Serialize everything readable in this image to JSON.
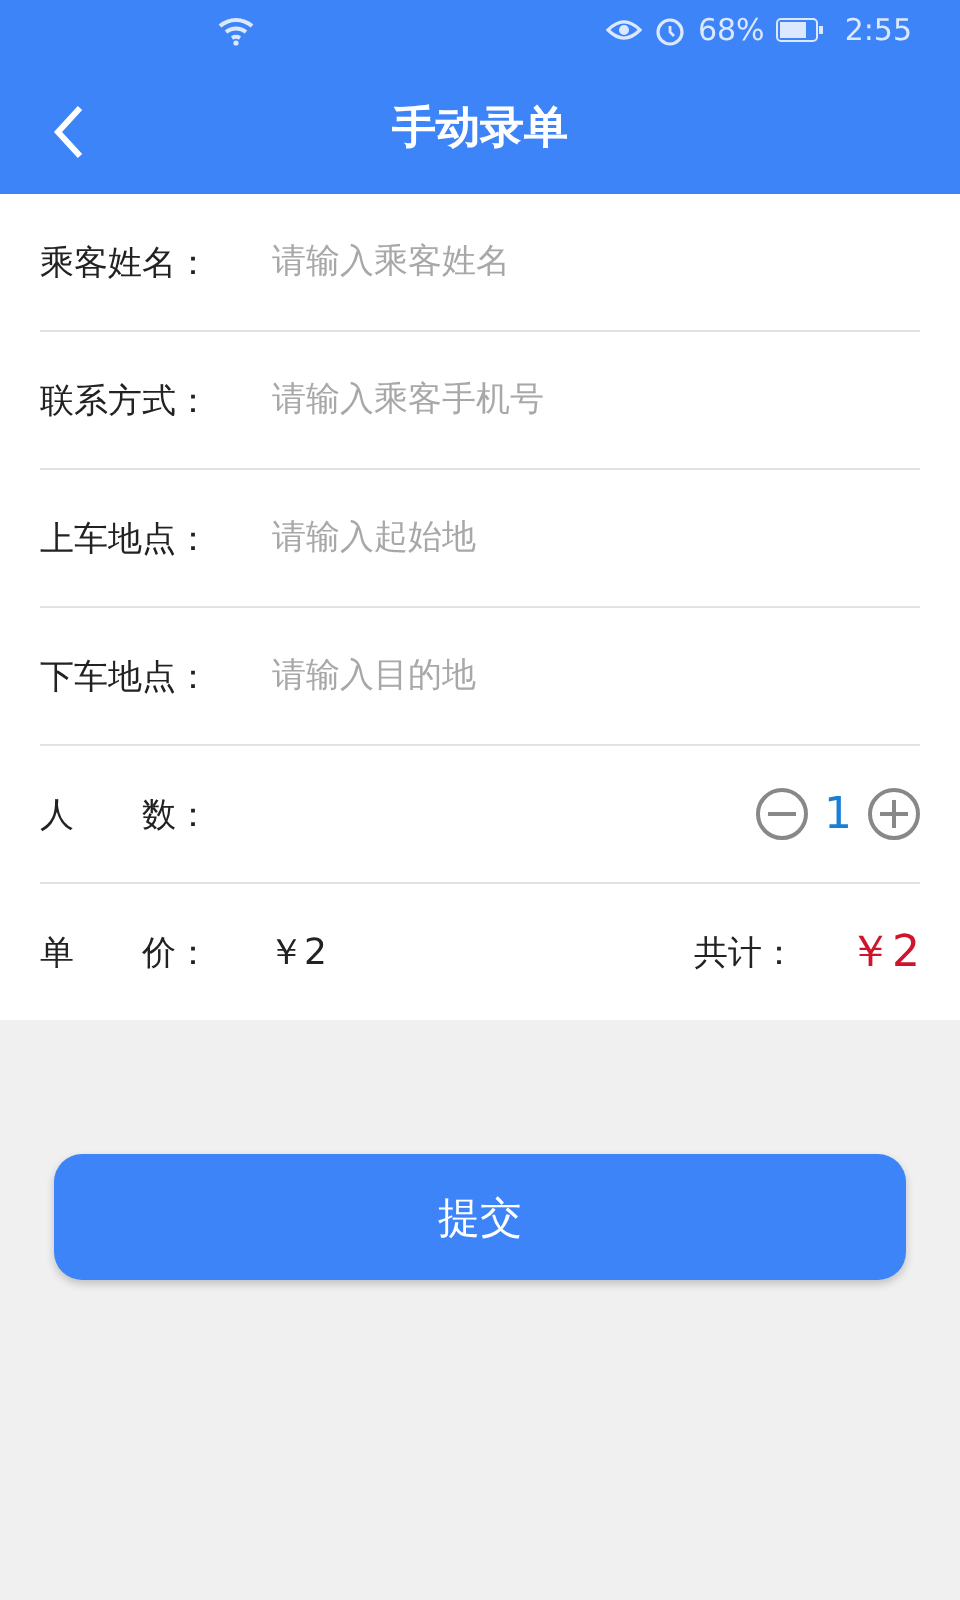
{
  "status_bar": {
    "battery_text": "68%",
    "time": "2:55"
  },
  "header": {
    "title": "手动录单"
  },
  "fields": [
    {
      "label": "乘客姓名：",
      "placeholder": "请输入乘客姓名"
    },
    {
      "label": "联系方式：",
      "placeholder": "请输入乘客手机号"
    },
    {
      "label": "上车地点：",
      "placeholder": "请输入起始地"
    },
    {
      "label": "下车地点：",
      "placeholder": "请输入目的地"
    }
  ],
  "count": {
    "label": "人　　数：",
    "value": "1"
  },
  "price": {
    "label": "单　　价：",
    "value": "￥2",
    "total_label": "共计：",
    "total": "￥2"
  },
  "submit": "提交"
}
